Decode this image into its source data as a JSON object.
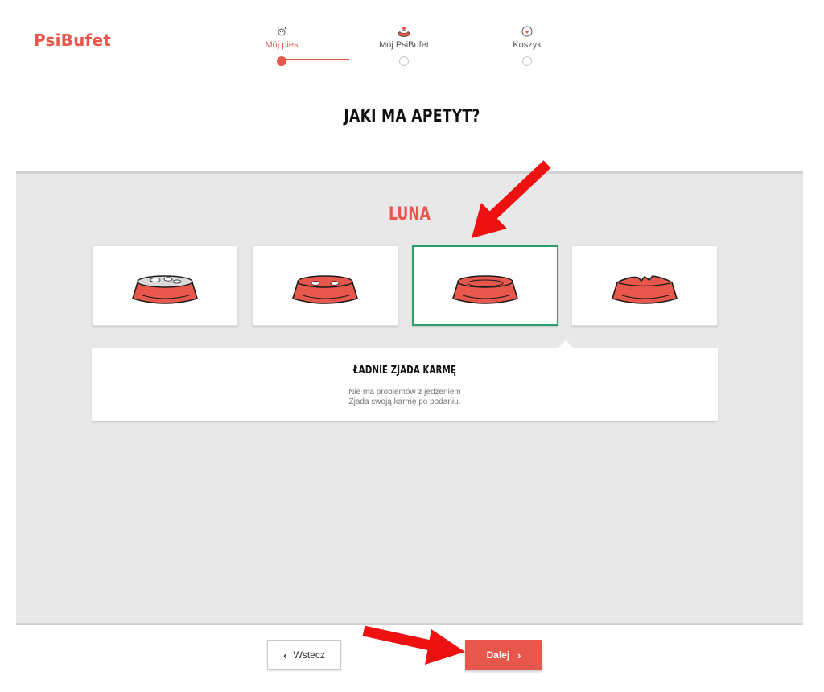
{
  "brand": {
    "name": "PsiBufet",
    "color": "#e8574b"
  },
  "steps": [
    {
      "label": "Mój pies",
      "icon": "dog-icon",
      "active": true
    },
    {
      "label": "Mój PsiBufet",
      "icon": "bowl-icon",
      "active": false
    },
    {
      "label": "Koszyk",
      "icon": "cart-icon",
      "active": false
    }
  ],
  "question": "JAKI MA APETYT?",
  "dog_name": "LUNA",
  "options": [
    {
      "icon": "full-bowl-icon",
      "selected": false
    },
    {
      "icon": "half-full-bowl-icon",
      "selected": false
    },
    {
      "icon": "empty-bowl-icon",
      "selected": true
    },
    {
      "icon": "chewed-bowl-icon",
      "selected": false
    }
  ],
  "description": {
    "title": "ŁADNIE ZJADA KARMĘ",
    "line1": "Nie ma problemów z jedzeniem",
    "line2": "Zjada swoją karmę po podaniu."
  },
  "buttons": {
    "back": "Wstecz",
    "next": "Dalej"
  },
  "colors": {
    "accent": "#e8574b",
    "selected_border": "#2f9e6d",
    "panel_bg": "#e8e8e8",
    "arrow": "#ee1111"
  }
}
